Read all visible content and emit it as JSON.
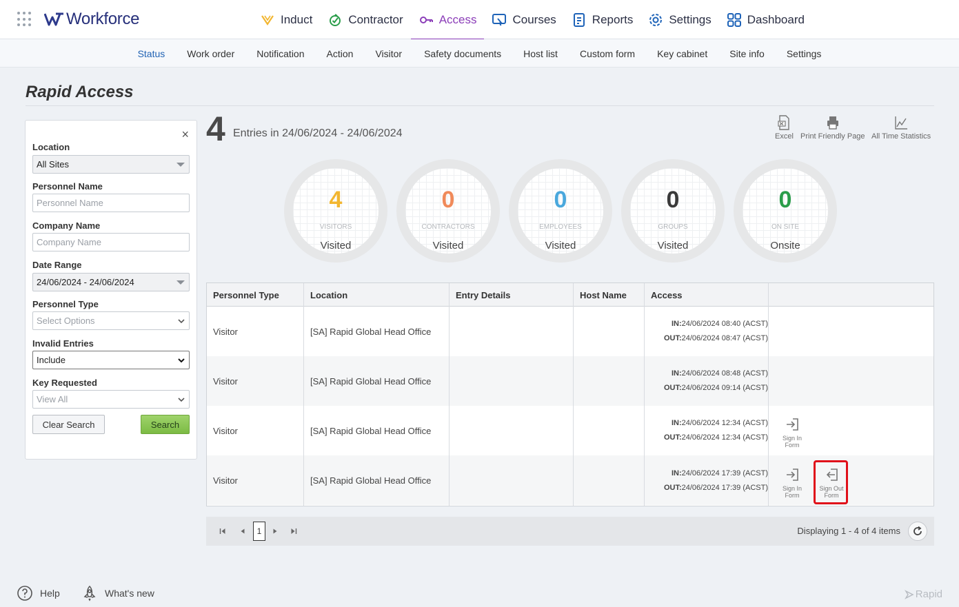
{
  "app": {
    "name": "Workforce"
  },
  "nav": {
    "items": [
      {
        "label": "Induct"
      },
      {
        "label": "Contractor"
      },
      {
        "label": "Access"
      },
      {
        "label": "Courses"
      },
      {
        "label": "Reports"
      },
      {
        "label": "Settings"
      },
      {
        "label": "Dashboard"
      }
    ],
    "active": "Access"
  },
  "subnav": {
    "items": [
      {
        "label": "Status"
      },
      {
        "label": "Work order"
      },
      {
        "label": "Notification"
      },
      {
        "label": "Action"
      },
      {
        "label": "Visitor"
      },
      {
        "label": "Safety documents"
      },
      {
        "label": "Host list"
      },
      {
        "label": "Custom form"
      },
      {
        "label": "Key cabinet"
      },
      {
        "label": "Site info"
      },
      {
        "label": "Settings"
      }
    ],
    "active": "Status"
  },
  "page": {
    "title": "Rapid Access"
  },
  "filter": {
    "close": "×",
    "location": {
      "label": "Location",
      "value": "All Sites"
    },
    "personnel_name": {
      "label": "Personnel Name",
      "placeholder": "Personnel Name"
    },
    "company_name": {
      "label": "Company Name",
      "placeholder": "Company Name"
    },
    "date_range": {
      "label": "Date Range",
      "value": "24/06/2024 - 24/06/2024"
    },
    "personnel_type": {
      "label": "Personnel Type",
      "placeholder": "Select Options"
    },
    "invalid_entries": {
      "label": "Invalid Entries",
      "value": "Include"
    },
    "key_requested": {
      "label": "Key Requested",
      "value": "View All"
    },
    "clear_label": "Clear Search",
    "search_label": "Search"
  },
  "summary": {
    "count": "4",
    "label": "Entries in 24/06/2024 - 24/06/2024",
    "tools": {
      "excel": "Excel",
      "print": "Print Friendly Page",
      "stats": "All Time Statistics"
    },
    "circles": [
      {
        "value": "4",
        "caption": "VISITORS",
        "sub": "Visited",
        "color": "#f2b630"
      },
      {
        "value": "0",
        "caption": "CONTRACTORS",
        "sub": "Visited",
        "color": "#f08a5a"
      },
      {
        "value": "0",
        "caption": "EMPLOYEES",
        "sub": "Visited",
        "color": "#4aa8dd"
      },
      {
        "value": "0",
        "caption": "GROUPS",
        "sub": "Visited",
        "color": "#3a3a3a"
      },
      {
        "value": "0",
        "caption": "ON SITE",
        "sub": "Onsite",
        "color": "#2a9d4a"
      }
    ]
  },
  "table": {
    "headers": [
      "Personnel Type",
      "Location",
      "Entry Details",
      "Host Name",
      "Access"
    ],
    "in_label": "IN:",
    "out_label": "OUT:",
    "rows": [
      {
        "type": "Visitor",
        "location": "[SA] Rapid Global Head Office",
        "entry": "",
        "host": "",
        "in": "24/06/2024 08:40 (ACST)",
        "out": "24/06/2024 08:47 (ACST)"
      },
      {
        "type": "Visitor",
        "location": "[SA] Rapid Global Head Office",
        "entry": "",
        "host": "",
        "in": "24/06/2024 08:48 (ACST)",
        "out": "24/06/2024 09:14 (ACST)"
      },
      {
        "type": "Visitor",
        "location": "[SA] Rapid Global Head Office",
        "entry": "",
        "host": "",
        "in": "24/06/2024 12:34 (ACST)",
        "out": "24/06/2024 12:34 (ACST)"
      },
      {
        "type": "Visitor",
        "location": "[SA] Rapid Global Head Office",
        "entry": "",
        "host": "",
        "in": "24/06/2024 17:39 (ACST)",
        "out": "24/06/2024 17:39 (ACST)"
      }
    ],
    "actions": {
      "sign_in_1": "Sign In",
      "sign_in_2": "Form",
      "sign_out_1": "Sign Out",
      "sign_out_2": "Form"
    }
  },
  "pager": {
    "page": "1",
    "display": "Displaying 1 - 4 of 4 items"
  },
  "footer": {
    "help": "Help",
    "whats_new": "What's new",
    "brand": "Rapid"
  }
}
